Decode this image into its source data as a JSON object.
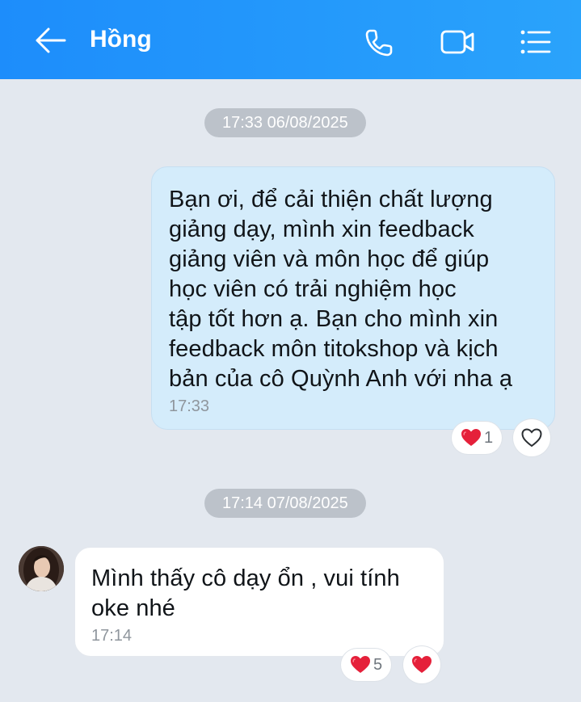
{
  "header": {
    "contact_name": "Hồng",
    "back_icon": "arrow-left-icon",
    "call_icon": "phone-icon",
    "video_icon": "video-camera-icon",
    "menu_icon": "list-menu-icon",
    "background_color": "#1d8dfb"
  },
  "messages": [
    {
      "date_separator": "17:33 06/08/2025",
      "direction": "outgoing",
      "text": "Bạn ơi, để cải thiện chất lượng\ngiảng dạy, mình xin feedback\ngiảng viên và môn học để giúp\nhọc viên có trải nghiệm học\ntập tốt hơn ạ. Bạn cho mình xin\nfeedback môn titokshop và kịch\nbản của cô Quỳnh Anh với nha ạ",
      "time": "17:33",
      "reaction_count": "1",
      "reaction_icon": "heart-filled-icon",
      "react_button_icon": "heart-outline-icon"
    },
    {
      "date_separator": "17:14 07/08/2025",
      "direction": "incoming",
      "text": "Mình thấy cô dạy ổn , vui tính\noke nhé",
      "time": "17:14",
      "reaction_count": "5",
      "reaction_icon": "heart-filled-icon",
      "react_button_icon": "heart-filled-icon"
    }
  ],
  "colors": {
    "chat_background": "#e3e8ef",
    "outgoing_bubble": "#d4ecfb",
    "incoming_bubble": "#ffffff",
    "heart": "#e5203a"
  }
}
